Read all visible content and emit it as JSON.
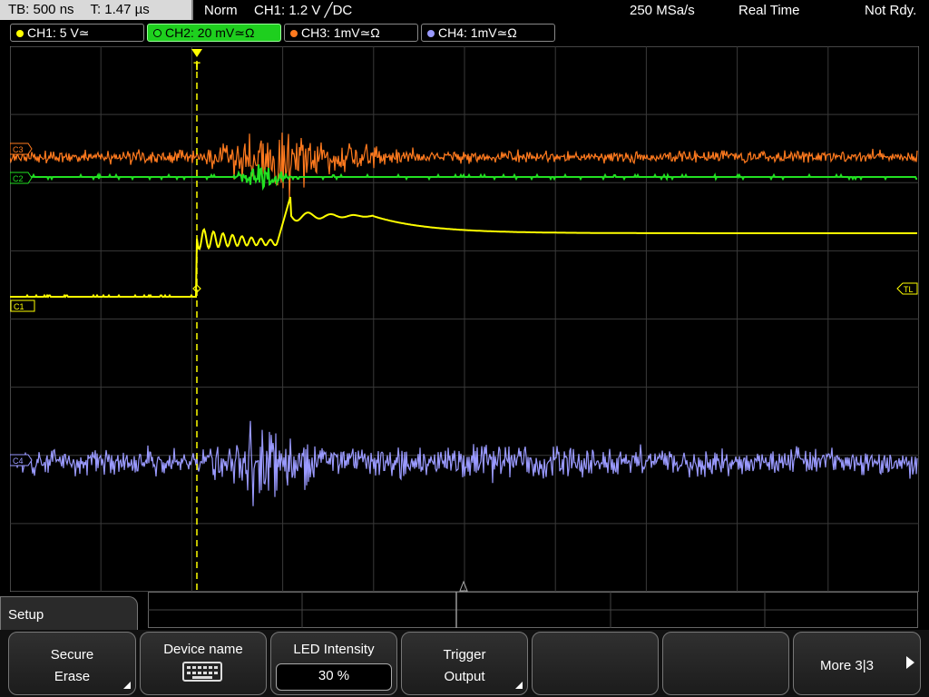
{
  "status_bar": {
    "timebase": "TB: 500 ns",
    "trigger_time": "T: 1.47 µs",
    "trigger_mode": "Norm",
    "trigger_source": "CH1: 1.2 V ╱DC",
    "sample_rate": "250 MSa/s",
    "acquisition_mode": "Real Time",
    "status": "Not Rdy."
  },
  "channels": [
    {
      "label": "CH1: 5 V≃",
      "color": "#ffff00",
      "active": false
    },
    {
      "label": "CH2: 20 mV≃Ω",
      "color": "#22e022",
      "active": true
    },
    {
      "label": "CH3: 1mV≃Ω",
      "color": "#ff7a1e",
      "active": false
    },
    {
      "label": "CH4: 1mV≃Ω",
      "color": "#9a9aff",
      "active": false
    }
  ],
  "markers": {
    "ch3": "C3",
    "ch2": "C2",
    "ch1": "C1",
    "ch4": "C4",
    "trigger_level": "TL",
    "trigger_position": "T"
  },
  "menu": {
    "title": "Setup",
    "softkeys": [
      {
        "line1": "Secure",
        "line2": "Erase"
      },
      {
        "line1": "Device name",
        "icon": "keyboard-icon"
      },
      {
        "line1": "LED Intensity",
        "value": "30 %"
      },
      {
        "line1": "Trigger",
        "line2": "Output"
      },
      {
        "line1": ""
      },
      {
        "line1": ""
      },
      {
        "line1": "More 3|3"
      }
    ]
  }
}
